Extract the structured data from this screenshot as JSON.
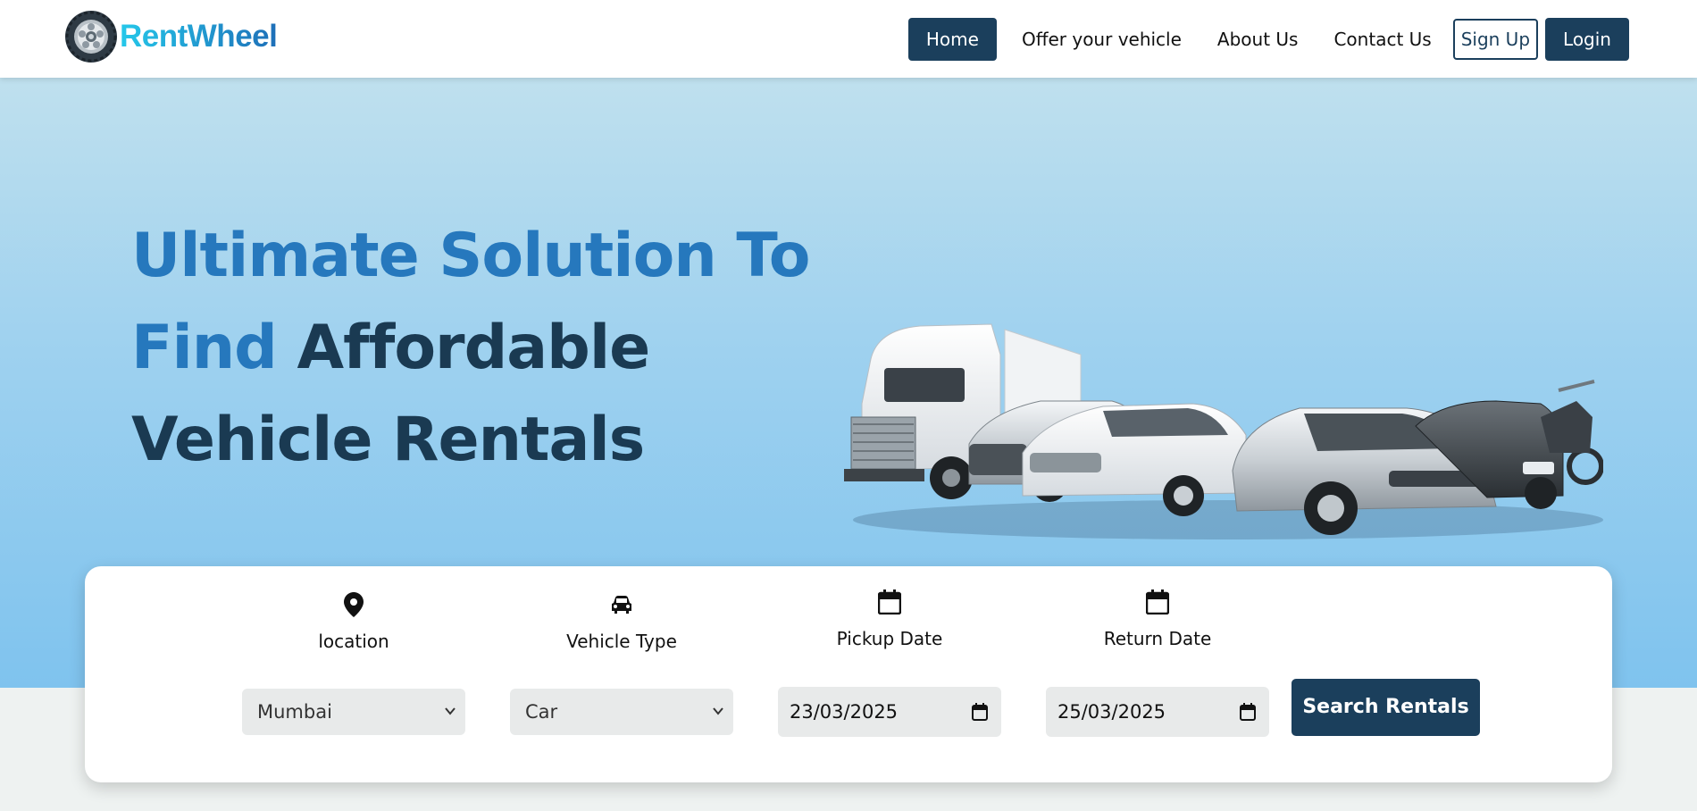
{
  "brand": {
    "name": "RentWheel"
  },
  "nav": {
    "items": [
      "Home",
      "Offer your vehicle",
      "About Us",
      "Contact Us"
    ],
    "active": "Home",
    "signup": "Sign Up",
    "login": "Login"
  },
  "hero": {
    "line1": "Ultimate Solution To",
    "line2_blue": "Find ",
    "line2_dark": "Affordable",
    "line3": "Vehicle Rentals"
  },
  "search": {
    "location": {
      "label": "location",
      "value": "Mumbai",
      "icon": "location-pin-icon"
    },
    "vehicle_type": {
      "label": "Vehicle Type",
      "value": "Car",
      "icon": "car-icon"
    },
    "pickup": {
      "label": "Pickup Date",
      "value": "23/03/2025",
      "icon": "calendar-icon"
    },
    "return": {
      "label": "Return Date",
      "value": "25/03/2025",
      "icon": "calendar-icon"
    },
    "button": "Search Rentals"
  },
  "colors": {
    "primary": "#1b3f5c",
    "accent_blue": "#2678bd",
    "brand_cyan": "#25c8ea"
  }
}
